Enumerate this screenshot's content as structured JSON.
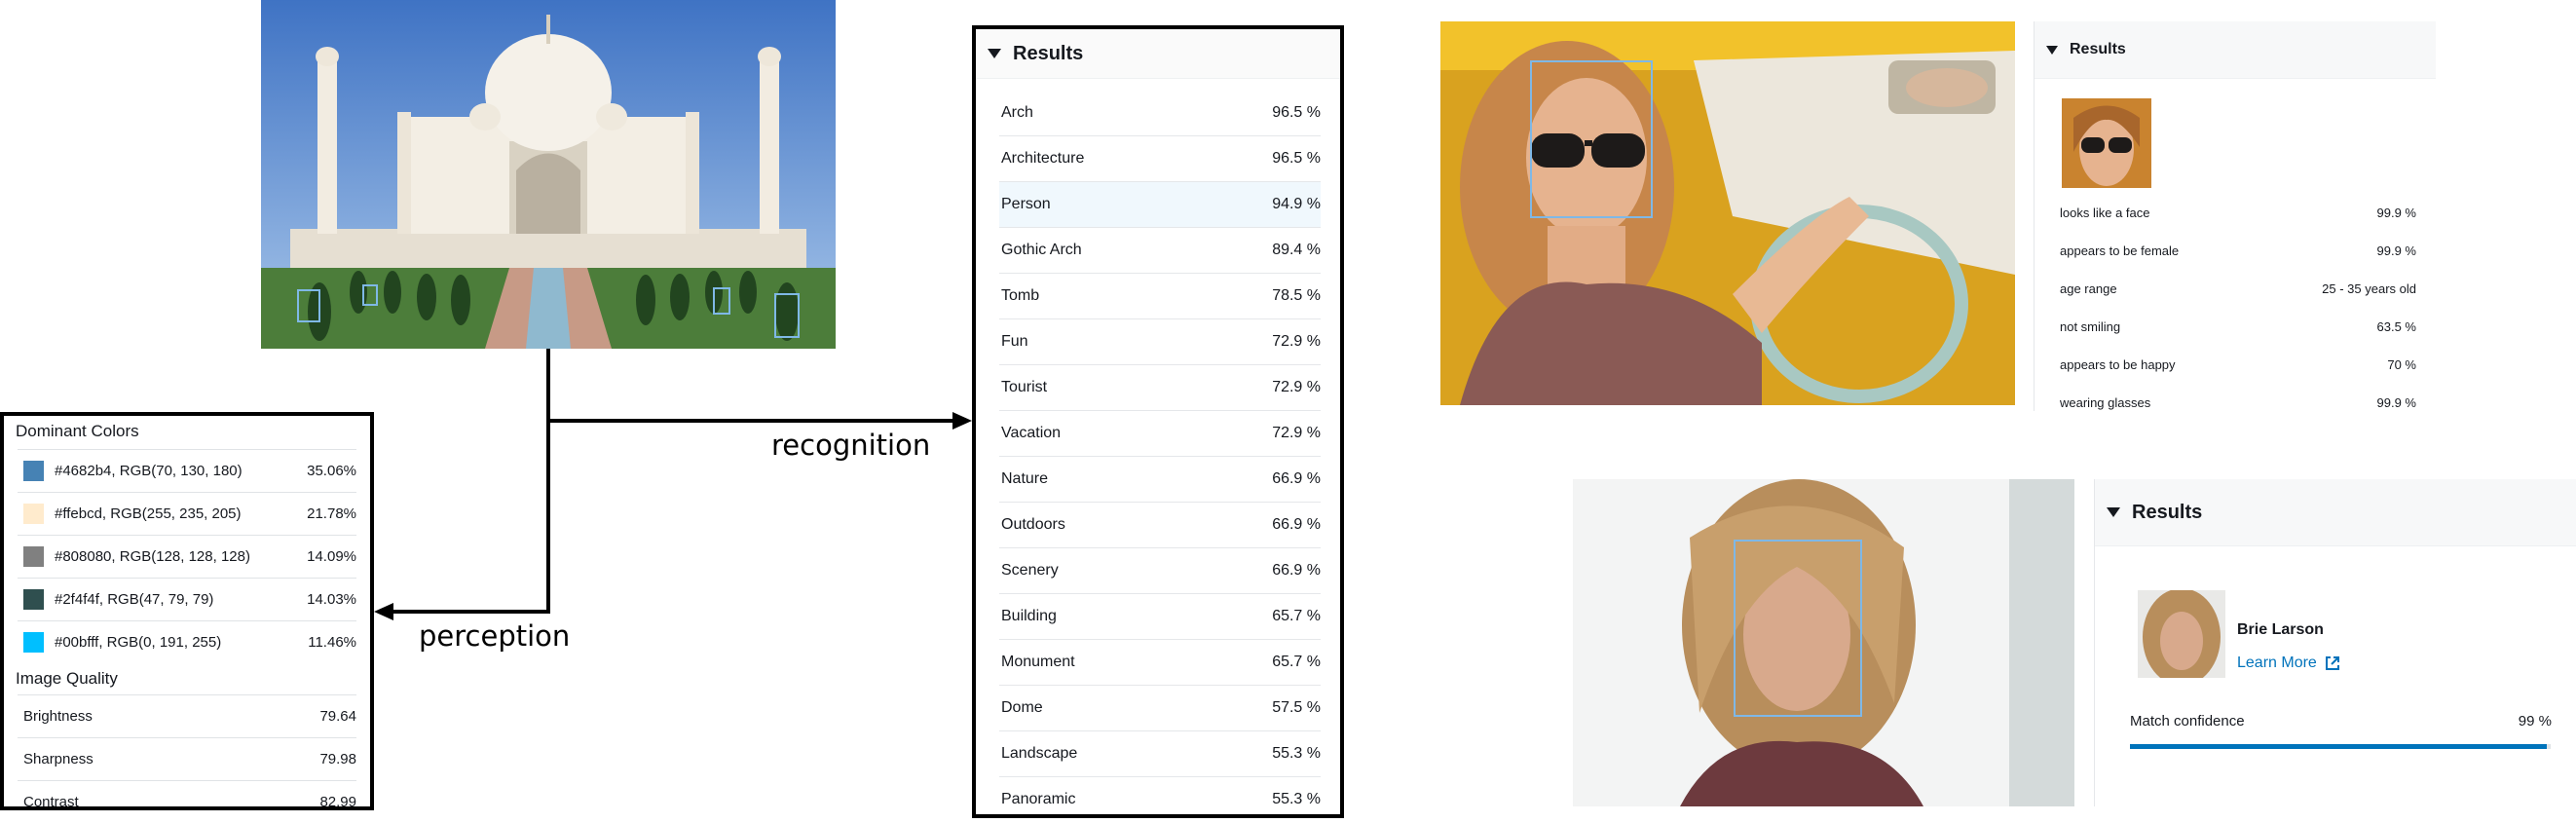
{
  "arrows": {
    "recognition": "recognition",
    "perception": "perception"
  },
  "perception": {
    "dominant_colors_title": "Dominant Colors",
    "colors": [
      {
        "swatch": "#4682b4",
        "label": "#4682b4, RGB(70, 130, 180)",
        "pct": "35.06%"
      },
      {
        "swatch": "#ffebcd",
        "label": "#ffebcd, RGB(255, 235, 205)",
        "pct": "21.78%"
      },
      {
        "swatch": "#808080",
        "label": "#808080, RGB(128, 128, 128)",
        "pct": "14.09%"
      },
      {
        "swatch": "#2f4f4f",
        "label": "#2f4f4f, RGB(47, 79, 79)",
        "pct": "14.03%"
      },
      {
        "swatch": "#00bfff",
        "label": "#00bfff, RGB(0, 191, 255)",
        "pct": "11.46%"
      }
    ],
    "image_quality_title": "Image Quality",
    "quality": [
      {
        "label": "Brightness",
        "value": "79.64"
      },
      {
        "label": "Sharpness",
        "value": "79.98"
      },
      {
        "label": "Contrast",
        "value": "82.99"
      }
    ]
  },
  "recognition": {
    "title": "Results",
    "labels": [
      {
        "label": "Arch",
        "pct": "96.5 %"
      },
      {
        "label": "Architecture",
        "pct": "96.5 %"
      },
      {
        "label": "Person",
        "pct": "94.9 %"
      },
      {
        "label": "Gothic Arch",
        "pct": "89.4 %"
      },
      {
        "label": "Tomb",
        "pct": "78.5 %"
      },
      {
        "label": "Fun",
        "pct": "72.9 %"
      },
      {
        "label": "Tourist",
        "pct": "72.9 %"
      },
      {
        "label": "Vacation",
        "pct": "72.9 %"
      },
      {
        "label": "Nature",
        "pct": "66.9 %"
      },
      {
        "label": "Outdoors",
        "pct": "66.9 %"
      },
      {
        "label": "Scenery",
        "pct": "66.9 %"
      },
      {
        "label": "Building",
        "pct": "65.7 %"
      },
      {
        "label": "Monument",
        "pct": "65.7 %"
      },
      {
        "label": "Dome",
        "pct": "57.5 %"
      },
      {
        "label": "Landscape",
        "pct": "55.3 %"
      },
      {
        "label": "Panoramic",
        "pct": "55.3 %"
      }
    ]
  },
  "face_analysis": {
    "title": "Results",
    "attributes": [
      {
        "label": "looks like a face",
        "value": "99.9 %"
      },
      {
        "label": "appears to be female",
        "value": "99.9 %"
      },
      {
        "label": "age range",
        "value": "25 - 35 years old"
      },
      {
        "label": "not smiling",
        "value": "63.5 %"
      },
      {
        "label": "appears to be happy",
        "value": "70 %"
      },
      {
        "label": "wearing glasses",
        "value": "99.9 %"
      }
    ]
  },
  "celebrity": {
    "title": "Results",
    "name": "Brie Larson",
    "learn_more": "Learn More",
    "match_label": "Match confidence",
    "match_value": "99 %",
    "match_fraction": 0.99
  },
  "colors": {
    "accent": "#0073bb",
    "box": "#7fb8e6"
  }
}
